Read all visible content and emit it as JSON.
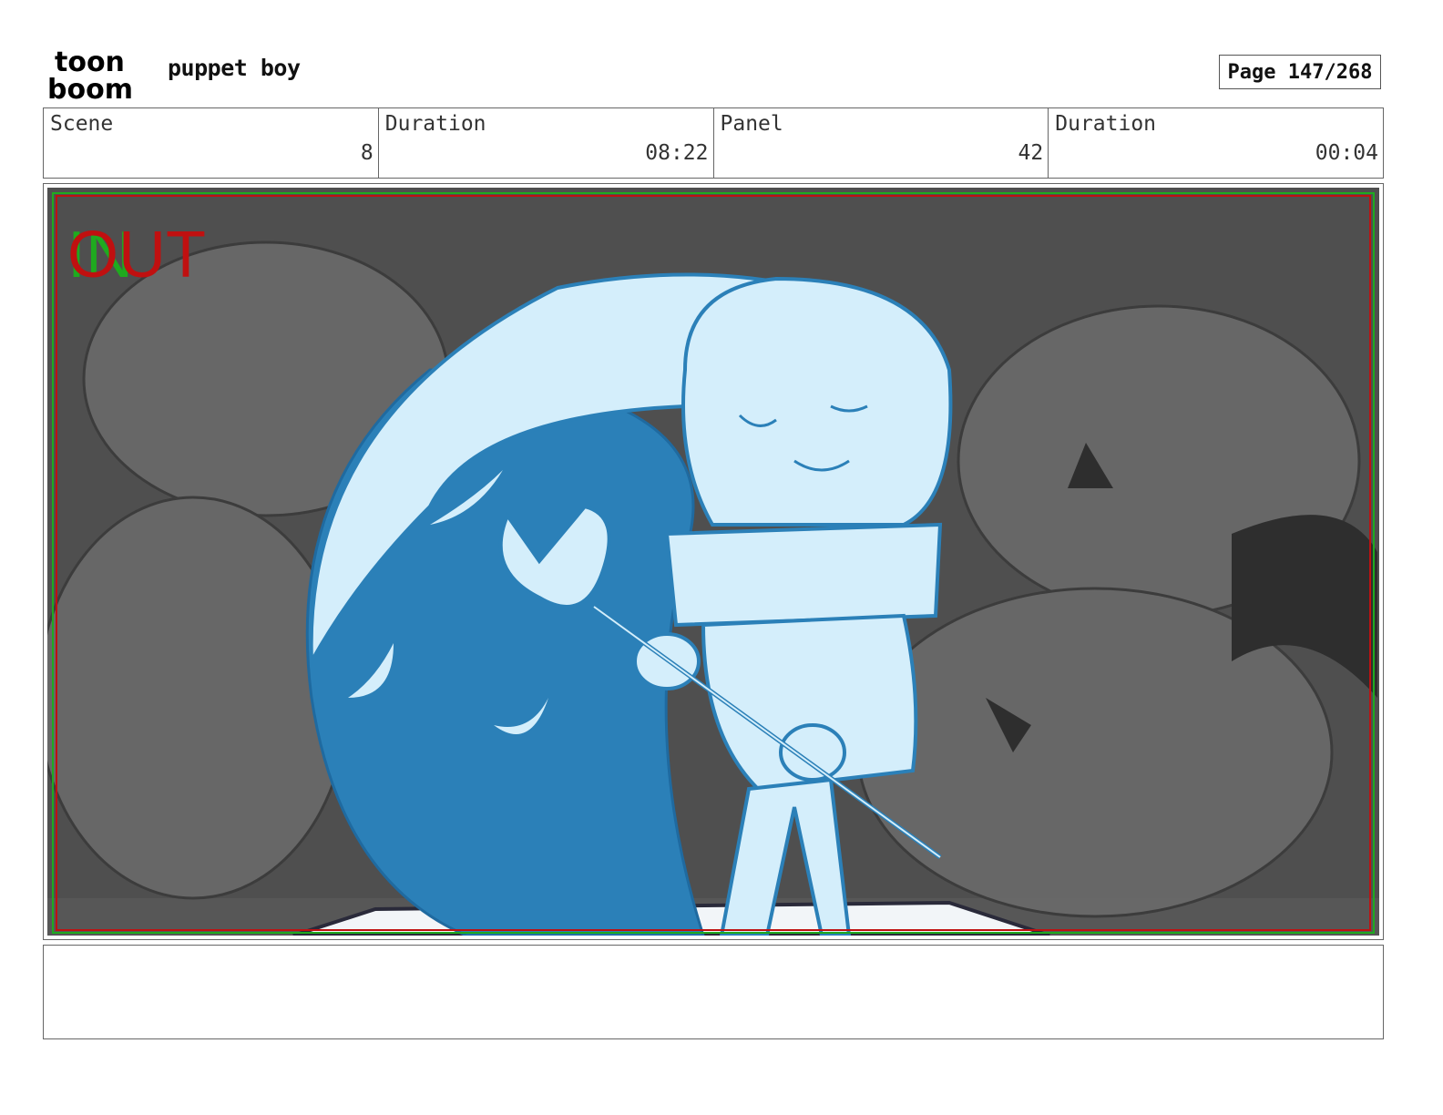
{
  "header": {
    "logo_text_top": "toon",
    "logo_text_bottom": "boom",
    "project_title": "puppet boy",
    "page_indicator": "Page 147/268"
  },
  "info": {
    "scene_label": "Scene",
    "scene_value": "8",
    "scene_duration_label": "Duration",
    "scene_duration_value": "08:22",
    "panel_label": "Panel",
    "panel_value": "42",
    "panel_duration_label": "Duration",
    "panel_duration_value": "00:04"
  },
  "panel": {
    "in_marker": "IN",
    "out_marker": "OUT",
    "in_color": "#1faa1f",
    "out_color": "#c01010",
    "figure_light": "#d4eefb",
    "figure_dark": "#2b80b8",
    "background_grey": "#5a5a5a"
  },
  "caption": {
    "text": ""
  }
}
